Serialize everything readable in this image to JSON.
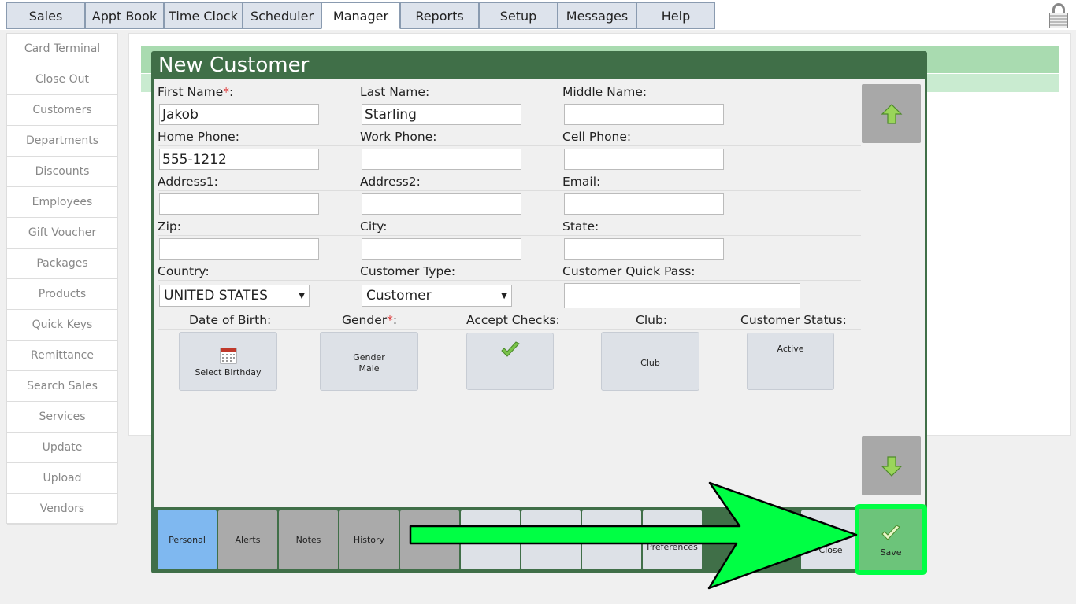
{
  "nav": {
    "tabs": [
      "Sales",
      "Appt Book",
      "Time Clock",
      "Scheduler",
      "Manager",
      "Reports",
      "Setup",
      "Messages",
      "Help"
    ],
    "active_tab": "Manager"
  },
  "sidebar": {
    "items": [
      {
        "label": "Card Terminal"
      },
      {
        "label": "Close Out"
      },
      {
        "label": "Customers"
      },
      {
        "label": "Departments"
      },
      {
        "label": "Discounts"
      },
      {
        "label": "Employees"
      },
      {
        "label": "Gift Voucher"
      },
      {
        "label": "Packages"
      },
      {
        "label": "Products"
      },
      {
        "label": "Quick Keys"
      },
      {
        "label": "Remittance"
      },
      {
        "label": "Search Sales"
      },
      {
        "label": "Services"
      },
      {
        "label": "Update"
      },
      {
        "label": "Upload"
      },
      {
        "label": "Vendors"
      }
    ]
  },
  "dialog": {
    "title": "New Customer",
    "fields": {
      "first_name": {
        "label": "First Name",
        "required_mark": "*",
        "suffix": ":",
        "value": "Jakob"
      },
      "last_name": {
        "label": "Last Name:",
        "value": "Starling"
      },
      "middle_name": {
        "label": "Middle Name:",
        "value": ""
      },
      "home_phone": {
        "label": "Home Phone:",
        "value": "555-1212"
      },
      "work_phone": {
        "label": "Work Phone:",
        "value": ""
      },
      "cell_phone": {
        "label": "Cell Phone:",
        "value": ""
      },
      "address1": {
        "label": "Address1:",
        "value": ""
      },
      "address2": {
        "label": "Address2:",
        "value": ""
      },
      "email": {
        "label": "Email:",
        "value": ""
      },
      "zip": {
        "label": "Zip:",
        "value": ""
      },
      "city": {
        "label": "City:",
        "value": ""
      },
      "state": {
        "label": "State:",
        "value": ""
      },
      "country": {
        "label": "Country:",
        "value": "UNITED STATES"
      },
      "customer_type": {
        "label": "Customer Type:",
        "value": "Customer"
      },
      "quick_pass": {
        "label": "Customer Quick Pass:",
        "value": ""
      }
    },
    "options": {
      "dob": {
        "label": "Date of Birth:",
        "button": "Select Birthday"
      },
      "gender": {
        "label": "Gender",
        "required_mark": "*",
        "suffix": ":",
        "line1": "Gender",
        "line2": "Male"
      },
      "accept_checks": {
        "label": "Accept Checks:"
      },
      "club": {
        "label": "Club:",
        "button": "Club"
      },
      "status": {
        "label": "Customer Status:",
        "button": "Active"
      }
    },
    "toolbar": {
      "personal": "Personal",
      "alerts": "Alerts",
      "notes": "Notes",
      "history": "History",
      "preferences": "Preferences",
      "close": "Close",
      "save": "Save"
    }
  },
  "colors": {
    "dialog_green": "#406f48",
    "callout_arrow": "#00ff44",
    "active_tab_blue": "#7fb8f0"
  }
}
